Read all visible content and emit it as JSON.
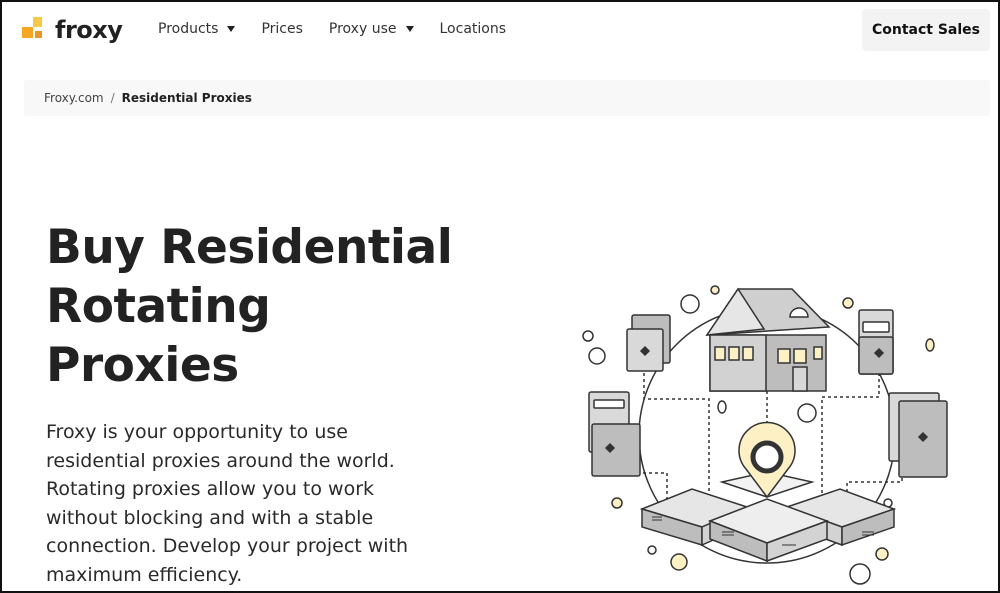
{
  "brand": {
    "name": "froxy"
  },
  "nav": {
    "items": [
      {
        "label": "Products",
        "dropdown": true
      },
      {
        "label": "Prices",
        "dropdown": false
      },
      {
        "label": "Proxy use",
        "dropdown": true
      },
      {
        "label": "Locations",
        "dropdown": false
      }
    ]
  },
  "header": {
    "contact_label": "Contact Sales"
  },
  "breadcrumb": {
    "home": "Froxy.com",
    "separator": "/",
    "current": "Residential Proxies"
  },
  "hero": {
    "title_lines": [
      "Buy Residential",
      "Rotating",
      "Proxies"
    ],
    "description": "Froxy is your opportunity to use residential proxies around the world. Rotating proxies allow you to work without blocking and with a stable connection. Develop your project with maximum efficiency."
  },
  "colors": {
    "accent": "#f5a623",
    "accent_light": "#f7c948",
    "illustration_gray": "#bdbdbd",
    "pin_fill": "#fdf0c4"
  },
  "icons": [
    "froxy-logo-icon",
    "chevron-down-icon",
    "house-icon",
    "location-pin-icon",
    "server-icon",
    "device-icon"
  ]
}
